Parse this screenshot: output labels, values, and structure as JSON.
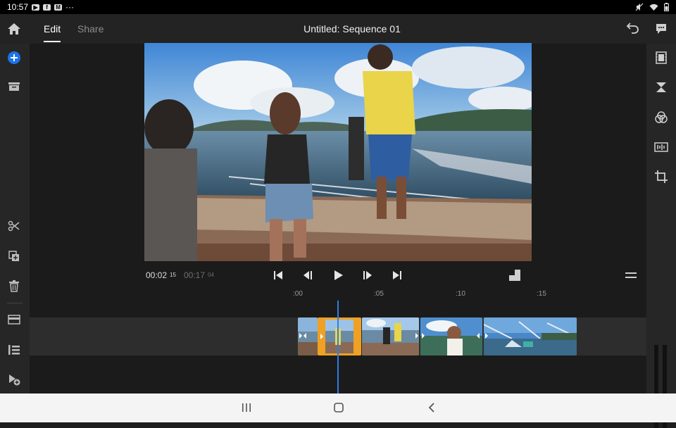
{
  "status": {
    "time": "10:57",
    "more": "···"
  },
  "header": {
    "tabs": [
      {
        "label": "Edit",
        "active": true
      },
      {
        "label": "Share",
        "active": false
      }
    ],
    "title": "Untitled: Sequence 01"
  },
  "icons": {
    "left": [
      "home-icon",
      "add-icon",
      "media-bin-icon",
      "scissors-icon",
      "duplicate-icon",
      "trash-icon",
      "archive-icon",
      "list-icon",
      "add-clip-icon"
    ],
    "right": [
      "comment-icon",
      "film-icon",
      "transition-icon",
      "color-icon",
      "audio-icon",
      "crop-icon"
    ],
    "accent": "#1a73e8",
    "selection": "#f0a023",
    "playhead": "#2f7ee8"
  },
  "playback": {
    "current": "00:02",
    "current_frames": "15",
    "total": "00:17",
    "total_frames": "04"
  },
  "ruler": {
    "labels": [
      ":00",
      ":05",
      ":10",
      ":15"
    ]
  }
}
